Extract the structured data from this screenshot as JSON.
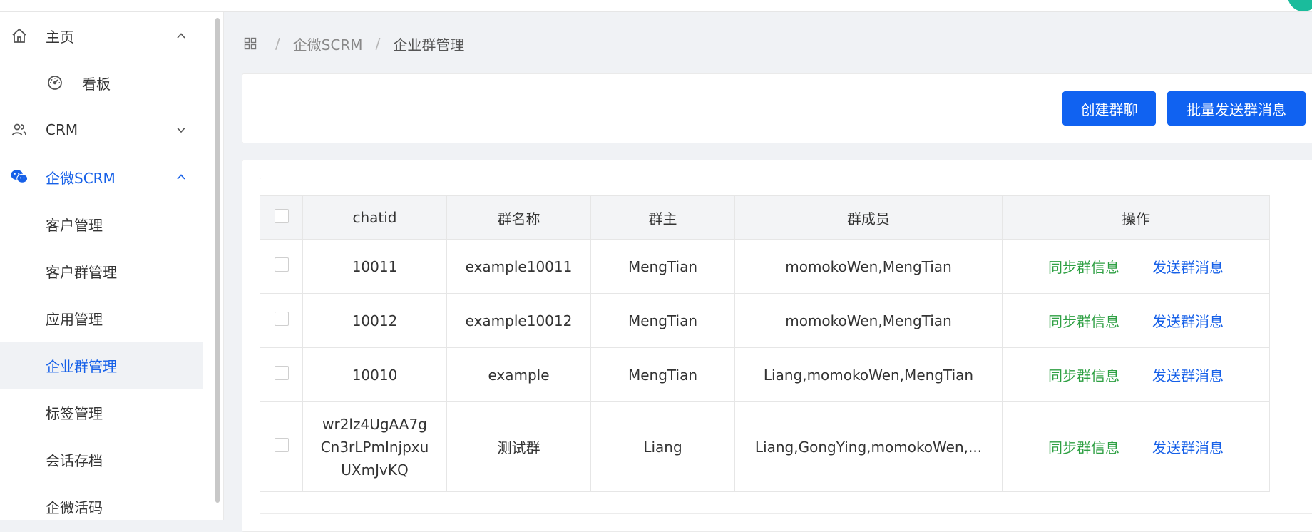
{
  "sidebar": {
    "items": [
      {
        "label": "主页",
        "icon": "home-icon",
        "arrow": "chevron-up-icon"
      },
      {
        "label": "看板",
        "icon": "dashboard-icon"
      },
      {
        "label": "CRM",
        "icon": "users-icon",
        "arrow": "chevron-down-icon"
      },
      {
        "label": "企微SCRM",
        "icon": "wechat-icon",
        "arrow": "chevron-up-icon"
      },
      {
        "label": "客户管理"
      },
      {
        "label": "客户群管理"
      },
      {
        "label": "应用管理"
      },
      {
        "label": "企业群管理"
      },
      {
        "label": "标签管理"
      },
      {
        "label": "会话存档"
      },
      {
        "label": "企微活码"
      }
    ]
  },
  "breadcrumb": {
    "items": [
      "企微SCRM",
      "企业群管理"
    ],
    "separator": "/"
  },
  "toolbar": {
    "create_label": "创建群聊",
    "batch_label": "批量发送群消息"
  },
  "table": {
    "columns": [
      "chatid",
      "群名称",
      "群主",
      "群成员",
      "操作"
    ],
    "rows": [
      {
        "chatid": "10011",
        "name": "example10011",
        "owner": "MengTian",
        "members": "momokoWen,MengTian",
        "sync": "同步群信息",
        "send": "发送群消息"
      },
      {
        "chatid": "10012",
        "name": "example10012",
        "owner": "MengTian",
        "members": "momokoWen,MengTian",
        "sync": "同步群信息",
        "send": "发送群消息"
      },
      {
        "chatid": "10010",
        "name": "example",
        "owner": "MengTian",
        "members": "Liang,momokoWen,MengTian",
        "sync": "同步群信息",
        "send": "发送群消息"
      },
      {
        "chatid": "wr2lz4UgAA7gCn3rLPmInjpxuUXmJvKQ",
        "name": "测试群",
        "owner": "Liang",
        "members": "Liang,GongYing,momokoWen,...",
        "sync": "同步群信息",
        "send": "发送群消息"
      }
    ]
  },
  "colors": {
    "primary": "#1062f1",
    "link_green": "#2ea043",
    "link_blue": "#1660e8",
    "page_bg": "#f0f2f5"
  }
}
